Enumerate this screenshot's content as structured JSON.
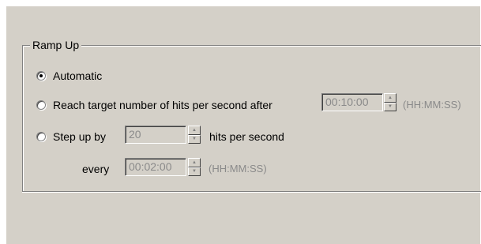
{
  "group": {
    "title": "Ramp Up"
  },
  "options": {
    "automatic": {
      "label": "Automatic",
      "checked": true
    },
    "reach_target": {
      "label": "Reach target number of hits per second after",
      "checked": false,
      "time_value": "00:10:00",
      "format_hint": "(HH:MM:SS)"
    },
    "step_up": {
      "label": "Step up by",
      "checked": false,
      "step_value": "20",
      "unit_label": "hits per second",
      "every_label": "every",
      "every_value": "00:02:00",
      "format_hint": "(HH:MM:SS)"
    }
  },
  "icons": {
    "spin_up": "spin-up-arrow-icon",
    "spin_down": "spin-down-arrow-icon"
  },
  "colors": {
    "dialog_bg": "#d4d0c8",
    "disabled_text": "#8a8a8a"
  }
}
